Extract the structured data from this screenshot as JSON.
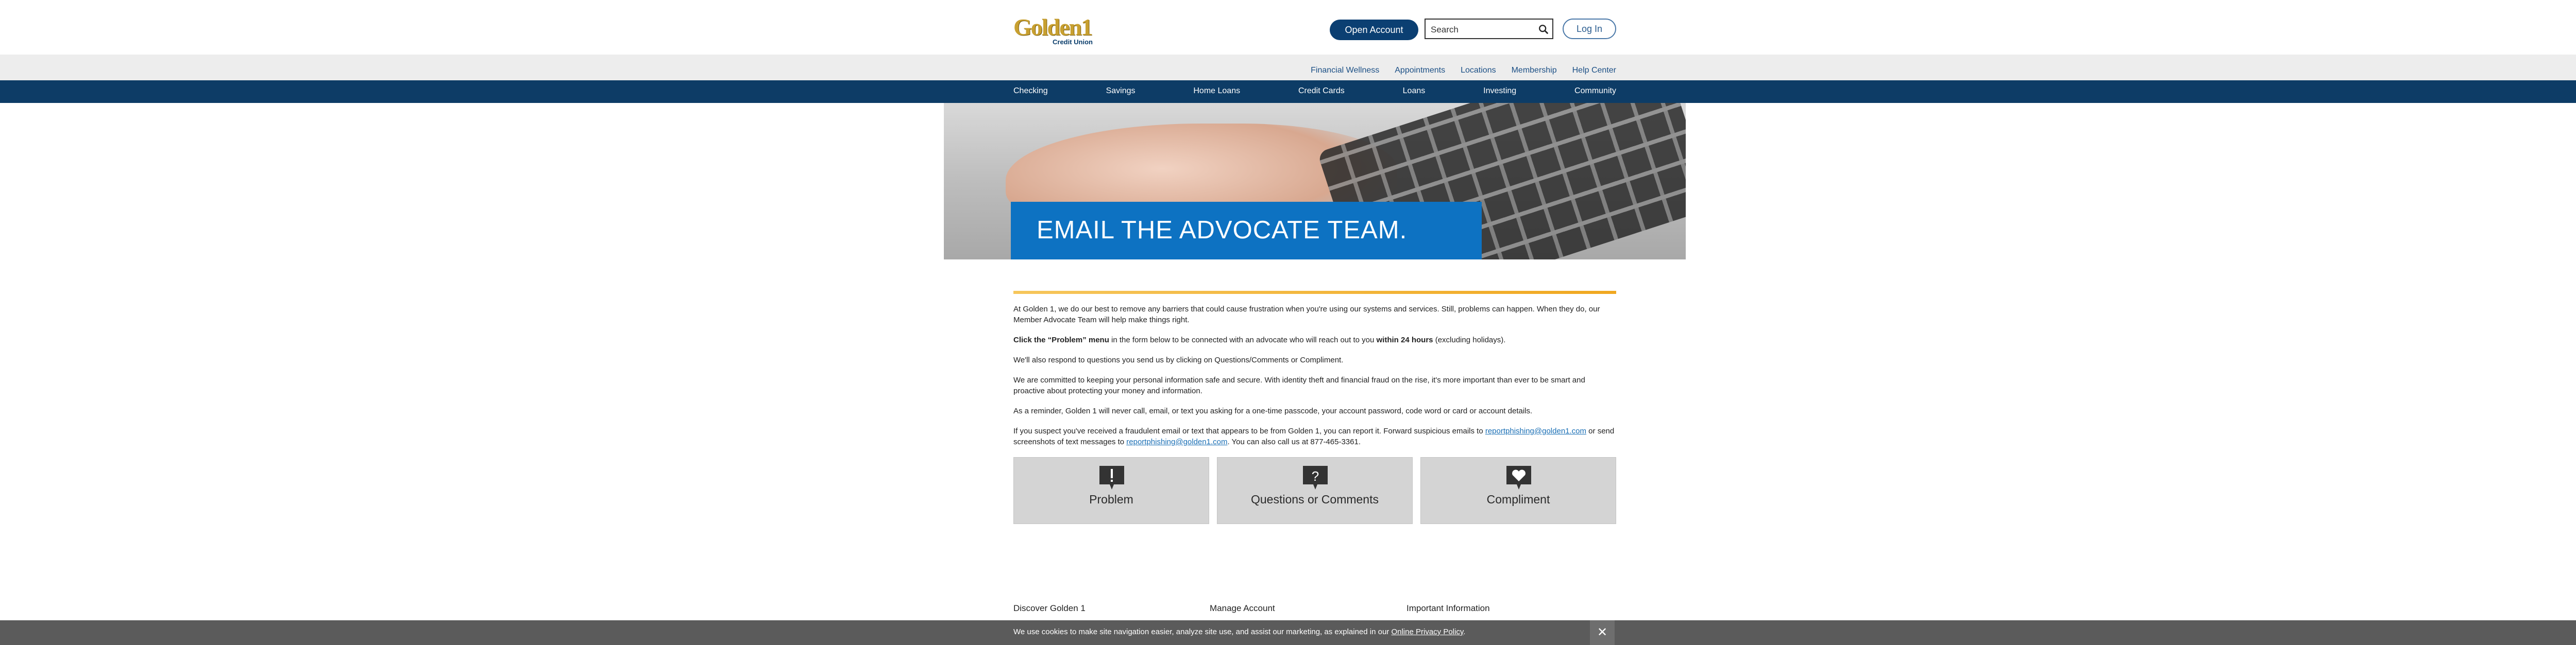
{
  "header": {
    "logo_text": "Golden1",
    "logo_sub": "Credit Union",
    "open_account": "Open Account",
    "search_placeholder": "Search",
    "login": "Log In"
  },
  "utility_nav": [
    "Financial Wellness",
    "Appointments",
    "Locations",
    "Membership",
    "Help Center"
  ],
  "main_nav": [
    "Checking",
    "Savings",
    "Home Loans",
    "Credit Cards",
    "Loans",
    "Investing",
    "Community"
  ],
  "hero": {
    "title": "EMAIL THE ADVOCATE TEAM."
  },
  "content": {
    "p1": "At Golden 1, we do our best to remove any barriers that could cause frustration when you're using our systems and services. Still, problems can happen. When they do, our Member Advocate Team will help make things right.",
    "p2_bold1": "Click the “Problem” menu",
    "p2_mid": " in the form below to be connected with an advocate who will reach out to you ",
    "p2_bold2": "within 24 hours",
    "p2_end": " (excluding holidays).",
    "p3": "We'll also respond to questions you send us by clicking on Questions/Comments or Compliment.",
    "p4": "We are committed to keeping your personal information safe and secure. With identity theft and financial fraud on the rise, it's more important than ever to be smart and proactive about protecting your money and information.",
    "p5": "As a reminder, Golden 1 will never call, email, or text you asking for a one-time passcode, your account password, code word or card or account details.",
    "p6_a": "If you suspect you've received a fraudulent email or text that appears to be from Golden 1, you can report it. Forward suspicious emails to ",
    "p6_link1": "reportphishing@golden1.com",
    "p6_b": " or send screenshots of text messages to ",
    "p6_link2": "reportphishing@golden1.com",
    "p6_c": ". You can also call us at 877-465-3361."
  },
  "tiles": [
    {
      "label": "Problem",
      "icon": "exclamation-speech-icon"
    },
    {
      "label": "Questions or Comments",
      "icon": "question-speech-icon"
    },
    {
      "label": "Compliment",
      "icon": "heart-speech-icon"
    }
  ],
  "footer": {
    "col1": "Discover Golden 1",
    "col2": "Manage Account",
    "col3": "Important Information"
  },
  "cookie": {
    "text": "We use cookies to make site navigation easier, analyze site use, and assist our marketing, as explained in our ",
    "link": "Online Privacy Policy",
    "end": ".",
    "close": "✕"
  },
  "colors": {
    "navy": "#0d3c66",
    "hero_blue": "#0d72c2",
    "gold": "#f0a820"
  }
}
